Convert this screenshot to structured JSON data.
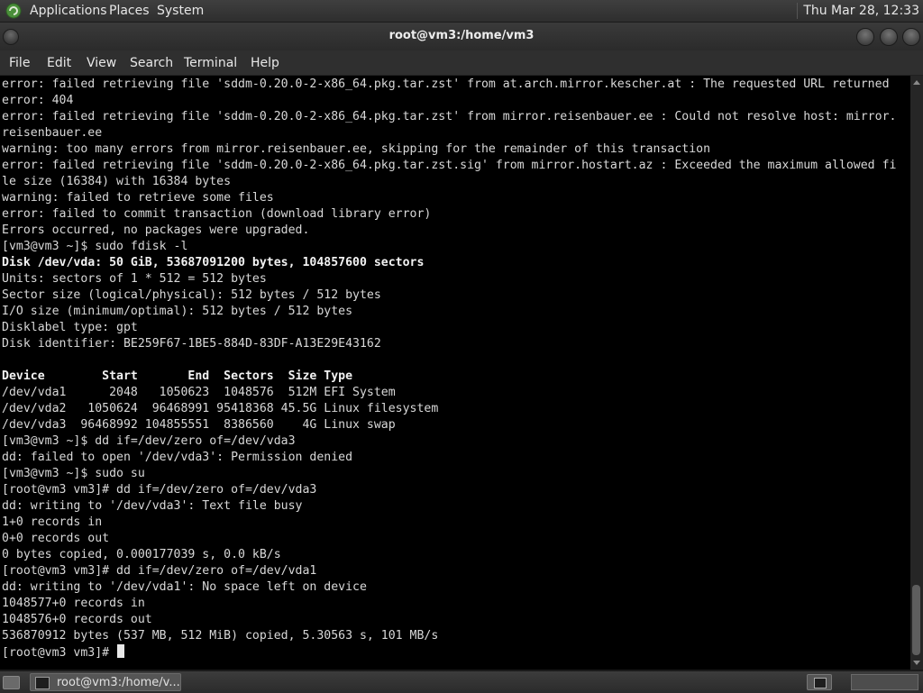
{
  "top_panel": {
    "menus": [
      "Applications",
      "Places",
      "System"
    ],
    "clock": "Thu Mar 28, 12:33",
    "logo_icon": "distro-logo-icon"
  },
  "window": {
    "title": "root@vm3:/home/vm3",
    "menu": [
      "File",
      "Edit",
      "View",
      "Search",
      "Terminal",
      "Help"
    ]
  },
  "terminal": {
    "lines": [
      {
        "text": "error: failed retrieving file 'sddm-0.20.0-2-x86_64.pkg.tar.zst' from at.arch.mirror.kescher.at : The requested URL returned",
        "bold": false
      },
      {
        "text": "error: 404",
        "bold": false
      },
      {
        "text": "error: failed retrieving file 'sddm-0.20.0-2-x86_64.pkg.tar.zst' from mirror.reisenbauer.ee : Could not resolve host: mirror.",
        "bold": false
      },
      {
        "text": "reisenbauer.ee",
        "bold": false
      },
      {
        "text": "warning: too many errors from mirror.reisenbauer.ee, skipping for the remainder of this transaction",
        "bold": false
      },
      {
        "text": "error: failed retrieving file 'sddm-0.20.0-2-x86_64.pkg.tar.zst.sig' from mirror.hostart.az : Exceeded the maximum allowed fi",
        "bold": false
      },
      {
        "text": "le size (16384) with 16384 bytes",
        "bold": false
      },
      {
        "text": "warning: failed to retrieve some files",
        "bold": false
      },
      {
        "text": "error: failed to commit transaction (download library error)",
        "bold": false
      },
      {
        "text": "Errors occurred, no packages were upgraded.",
        "bold": false
      },
      {
        "text": "[vm3@vm3 ~]$ sudo fdisk -l",
        "bold": false
      },
      {
        "text": "Disk /dev/vda: 50 GiB, 53687091200 bytes, 104857600 sectors",
        "bold": true
      },
      {
        "text": "Units: sectors of 1 * 512 = 512 bytes",
        "bold": false
      },
      {
        "text": "Sector size (logical/physical): 512 bytes / 512 bytes",
        "bold": false
      },
      {
        "text": "I/O size (minimum/optimal): 512 bytes / 512 bytes",
        "bold": false
      },
      {
        "text": "Disklabel type: gpt",
        "bold": false
      },
      {
        "text": "Disk identifier: BE259F67-1BE5-884D-83DF-A13E29E43162",
        "bold": false
      },
      {
        "text": "",
        "bold": false
      },
      {
        "text": "Device        Start       End  Sectors  Size Type",
        "bold": true
      },
      {
        "text": "/dev/vda1      2048   1050623  1048576  512M EFI System",
        "bold": false
      },
      {
        "text": "/dev/vda2   1050624  96468991 95418368 45.5G Linux filesystem",
        "bold": false
      },
      {
        "text": "/dev/vda3  96468992 104855551  8386560    4G Linux swap",
        "bold": false
      },
      {
        "text": "[vm3@vm3 ~]$ dd if=/dev/zero of=/dev/vda3",
        "bold": false
      },
      {
        "text": "dd: failed to open '/dev/vda3': Permission denied",
        "bold": false
      },
      {
        "text": "[vm3@vm3 ~]$ sudo su",
        "bold": false
      },
      {
        "text": "[root@vm3 vm3]# dd if=/dev/zero of=/dev/vda3",
        "bold": false
      },
      {
        "text": "dd: writing to '/dev/vda3': Text file busy",
        "bold": false
      },
      {
        "text": "1+0 records in",
        "bold": false
      },
      {
        "text": "0+0 records out",
        "bold": false
      },
      {
        "text": "0 bytes copied, 0.000177039 s, 0.0 kB/s",
        "bold": false
      },
      {
        "text": "[root@vm3 vm3]# dd if=/dev/zero of=/dev/vda1",
        "bold": false
      },
      {
        "text": "dd: writing to '/dev/vda1': No space left on device",
        "bold": false
      },
      {
        "text": "1048577+0 records in",
        "bold": false
      },
      {
        "text": "1048576+0 records out",
        "bold": false
      },
      {
        "text": "536870912 bytes (537 MB, 512 MiB) copied, 5.30563 s, 101 MB/s",
        "bold": false
      }
    ],
    "prompt": "[root@vm3 vm3]# "
  },
  "bottom_panel": {
    "task_label": "root@vm3:/home/v...",
    "show_desktop_icon": "show-desktop-icon",
    "tray_icon": "terminal-tray-icon"
  }
}
